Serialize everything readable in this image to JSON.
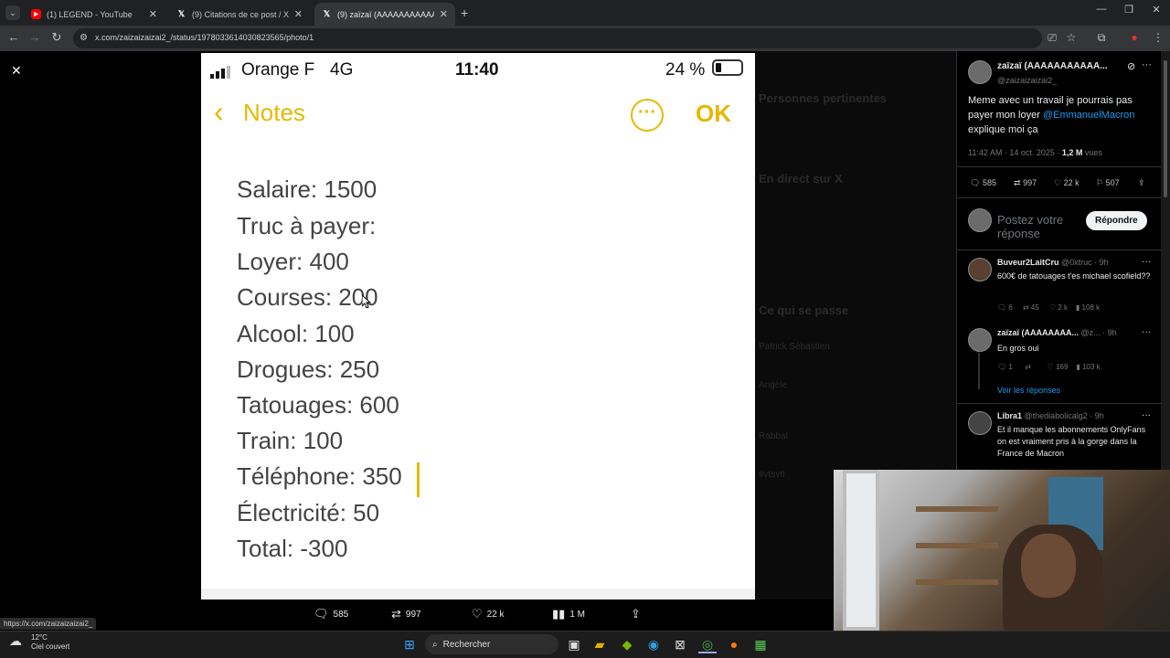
{
  "browser": {
    "tabs": [
      {
        "title": "(1) LEGEND - YouTube",
        "icon": "youtube-icon",
        "icon_color": "#ff0000"
      },
      {
        "title": "(9) Citations de ce post / X",
        "icon": "x-icon",
        "icon_color": "#ffffff"
      },
      {
        "title": "(9) zaïzaï (AAAAAAAAAAAAAAA…",
        "icon": "x-icon",
        "icon_color": "#ffffff"
      }
    ],
    "url": "x.com/zaizaizaizai2_/status/1978033614030823565/photo/1"
  },
  "photo": {
    "carrier": "Orange F",
    "network": "4G",
    "time": "11:40",
    "battery": "24 %",
    "back_label": "Notes",
    "ok_label": "OK",
    "accent": "#e6b800",
    "lines": [
      "Salaire: 1500",
      "Truc à payer:",
      "Loyer: 400",
      "Courses: 200",
      "Alcool: 100",
      "Drogues: 250",
      "Tatouages: 600",
      "Train: 100",
      "Téléphone: 350",
      "Électricité: 50",
      "Total: -300"
    ]
  },
  "bg_blurred": [
    "Personnes pertinentes",
    "En direct sur X",
    "Ce qui se passe",
    "Patrick Sébastien",
    "Angèle",
    "Rabbat",
    "#vtsvtl"
  ],
  "actions": {
    "replies": "585",
    "reposts": "997",
    "likes": "22 k",
    "views": "1 M"
  },
  "post": {
    "author": "zaïzaï (AAAAAAAAAAA...",
    "handle": "@zaizaizaizai2_",
    "text": "Meme avec un travail je pourrais pas payer mon loyer",
    "mention": "@EmmanuelMacron",
    "text2": "explique moi ça",
    "time": "11:42 AM · 14 oct. 2025 ·",
    "views": "1,2 M",
    "views_label": "vues",
    "replies": "585",
    "reposts": "997",
    "likes": "22 k",
    "bookmarks": "507",
    "reply_placeholder": "Postez votre réponse",
    "reply_button": "Répondre"
  },
  "replies": [
    {
      "author": "Buveur2LaitCru",
      "handle": "@0xtruc · 9h",
      "text": "600€ de tatouages t'es michael scofield??",
      "r": "6",
      "rt": "45",
      "l": "2 k",
      "v": "108 k"
    },
    {
      "author": "zaïzaï (AAAAAAAA...",
      "handle": "@z... · 9h",
      "text": "En gros oui",
      "r": "1",
      "rt": "",
      "l": "169",
      "v": "103 k",
      "show_more": "Voir les réponses"
    },
    {
      "author": "Libra1",
      "handle": "@thediabolicalg2 · 9h",
      "text": "Et il manque les abonnements OnlyFans on est vraiment pris à la gorge dans la France de Macron"
    }
  ],
  "status_url": "https://x.com/zaizaizaizai2_",
  "taskbar": {
    "temp": "12°C",
    "weather": "Ciel couvert",
    "search": "Rechercher"
  }
}
